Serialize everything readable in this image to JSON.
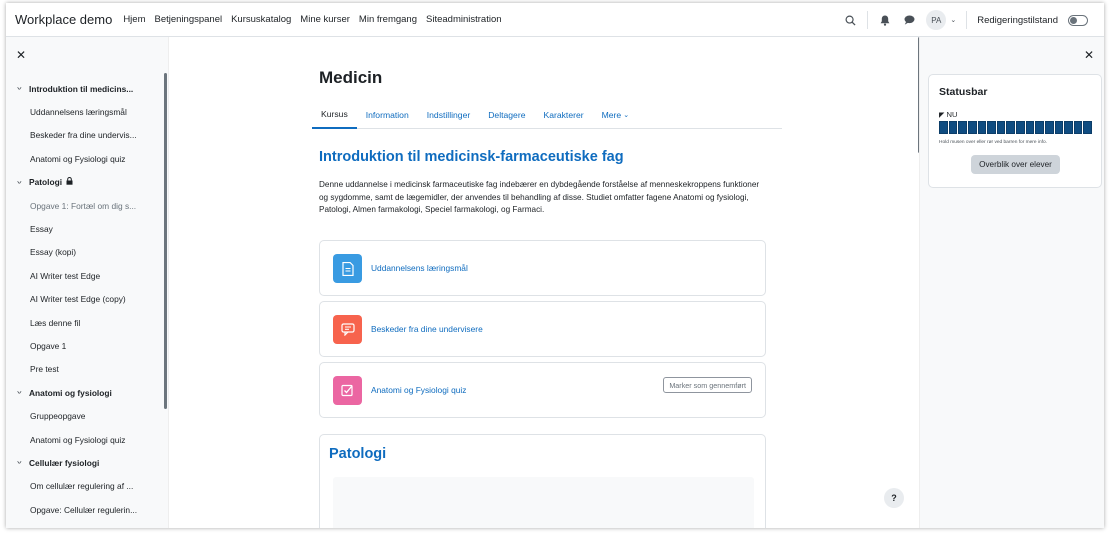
{
  "navbar": {
    "brand": "Workplace demo",
    "links": [
      "Hjem",
      "Betjeningspanel",
      "Kursuskatalog",
      "Mine kurser",
      "Min fremgang",
      "Siteadministration"
    ],
    "avatar_initials": "PA",
    "edit_mode_label": "Redigeringstilstand"
  },
  "course_index": {
    "close_icon": "close-icon",
    "rows": [
      {
        "type": "section",
        "label": "Introduktion til medicins..."
      },
      {
        "type": "item",
        "label": "Uddannelsens læringsmål"
      },
      {
        "type": "item",
        "label": "Beskeder fra dine undervis..."
      },
      {
        "type": "item",
        "label": "Anatomi og Fysiologi quiz"
      },
      {
        "type": "section",
        "label": "Patologi",
        "locked": true
      },
      {
        "type": "item",
        "label": "Opgave 1: Fortæl om dig s...",
        "dim": true
      },
      {
        "type": "item",
        "label": "Essay"
      },
      {
        "type": "item",
        "label": "Essay (kopi)"
      },
      {
        "type": "item",
        "label": "AI Writer test Edge"
      },
      {
        "type": "item",
        "label": "AI Writer test Edge (copy)"
      },
      {
        "type": "item",
        "label": "Læs denne fil"
      },
      {
        "type": "item",
        "label": "Opgave 1"
      },
      {
        "type": "item",
        "label": "Pre test"
      },
      {
        "type": "section",
        "label": "Anatomi og fysiologi"
      },
      {
        "type": "item",
        "label": "Gruppeopgave"
      },
      {
        "type": "item",
        "label": "Anatomi og Fysiologi quiz"
      },
      {
        "type": "section",
        "label": "Cellulær fysiologi"
      },
      {
        "type": "item",
        "label": "Om cellulær regulering af ..."
      },
      {
        "type": "item",
        "label": "Opgave: Cellulær regulerin..."
      }
    ]
  },
  "main": {
    "page_title": "Medicin",
    "tabs": [
      {
        "label": "Kursus",
        "active": true
      },
      {
        "label": "Information"
      },
      {
        "label": "Indstillinger"
      },
      {
        "label": "Deltagere"
      },
      {
        "label": "Karakterer"
      },
      {
        "label": "Mere",
        "dropdown": true
      }
    ],
    "section1": {
      "title": "Introduktion til medicinsk-farmaceutiske fag",
      "summary": "Denne uddannelse i medicinsk farmaceutiske fag indebærer en dybdegående forståelse af menneskekroppens funktioner og sygdomme, samt de lægemidler, der anvendes til behandling af disse. Studiet omfatter fagene Anatomi og fysiologi, Patologi, Almen farmakologi, Speciel farmakologi, og Farmaci."
    },
    "activities": [
      {
        "name": "Uddannelsens læringsmål",
        "icon": "page-icon",
        "color": "#399be2"
      },
      {
        "name": "Beskeder fra dine undervisere",
        "icon": "forum-icon",
        "color": "#f7634d"
      },
      {
        "name": "Anatomi og Fysiologi quiz",
        "icon": "quiz-icon",
        "color": "#eb66a2",
        "completion_button": "Marker som gennemført"
      }
    ],
    "section2": {
      "title": "Patologi"
    },
    "help_label": "?"
  },
  "right_drawer": {
    "block_title": "Statusbar",
    "now_label": "NU",
    "progress_cells": 16,
    "hint": "Hold musen over eller rør ved barren for mere info.",
    "overview_button": "Overblik over elever"
  },
  "colors": {
    "link": "#0f6cbf",
    "progress": "#0f4c81"
  }
}
